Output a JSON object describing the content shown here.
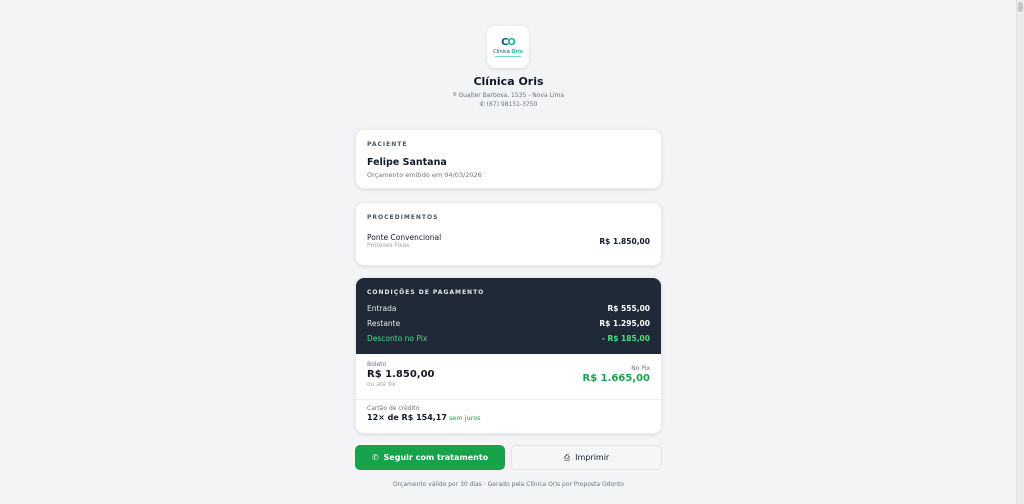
{
  "clinic": {
    "logo": {
      "mark_left": "C",
      "mark_right": "O",
      "text_left": "Clínica",
      "text_right": "Oris"
    },
    "name": "Clínica Oris",
    "address_icon": "map-pin-icon",
    "address": "Gualter Barbosa, 1535 - Nova Lima",
    "phone_icon": "phone-icon",
    "phone": "(67) 98151-3750"
  },
  "patient": {
    "section_label": "PACIENTE",
    "name": "Felipe Santana",
    "issued": "Orçamento emitido em 04/03/2026"
  },
  "procedures": {
    "section_label": "PROCEDIMENTOS",
    "items": [
      {
        "name": "Ponte Convencional",
        "category": "Próteses Fixas",
        "price": "R$ 1.850,00"
      }
    ]
  },
  "payment": {
    "section_label": "CONDIÇÕES DE PAGAMENTO",
    "down_payment_label": "Entrada",
    "down_payment_value": "R$ 555,00",
    "remaining_label": "Restante",
    "remaining_value": "R$ 1.295,00",
    "pix_discount_label": "Desconto no Pix",
    "pix_discount_value": "- R$ 185,00",
    "boleto_label": "Boleto",
    "boleto_value": "R$ 1.850,00",
    "boleto_sub": "ou até 9x",
    "pix_label": "No Pix",
    "pix_value": "R$ 1.665,00",
    "credit_label": "Cartão de crédito",
    "credit_value": "12× de R$ 154,17",
    "credit_tag": "sem juros"
  },
  "actions": {
    "primary_label": "Seguir com tratamento",
    "primary_icon": "whatsapp-icon",
    "secondary_label": "Imprimir",
    "secondary_icon": "printer-icon"
  },
  "footer": "Orçamento válido por 30 dias · Gerado pela Clínica Oris por Proposta Odonto",
  "colors": {
    "accent_green": "#16a34a",
    "dark_panel": "#1f2937",
    "logo_blue": "#0f4c81",
    "logo_teal": "#14b8a6"
  }
}
